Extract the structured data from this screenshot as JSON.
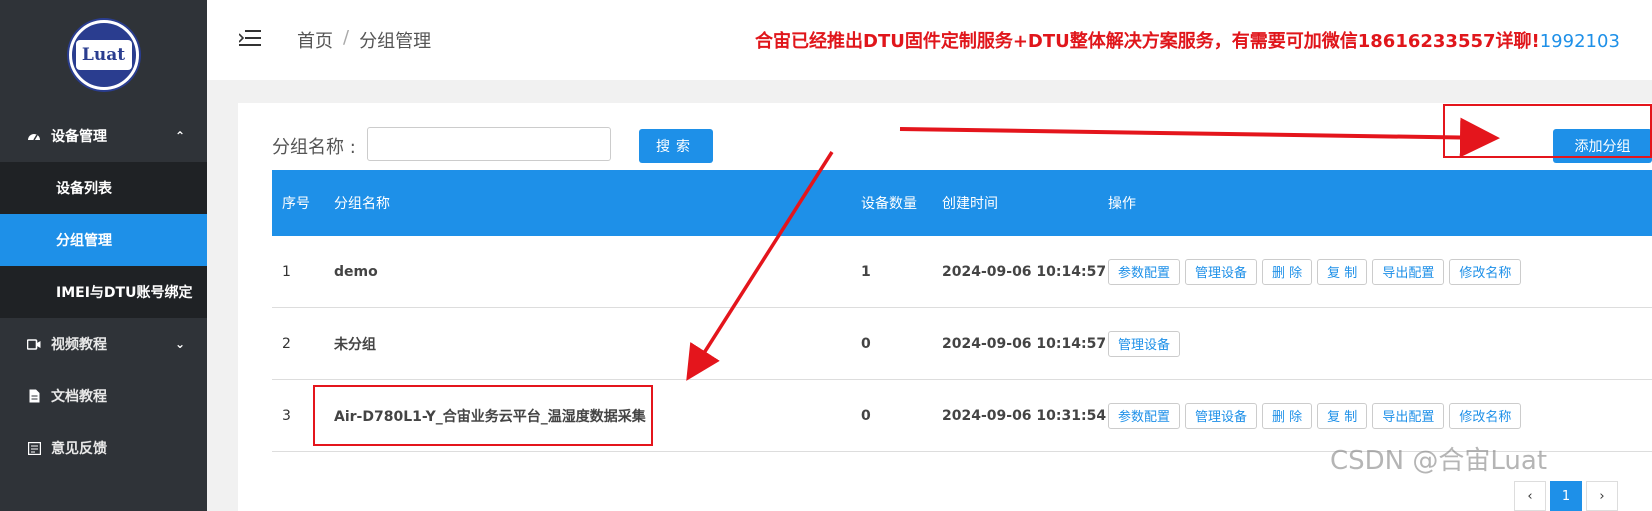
{
  "logo": {
    "text": "Luat"
  },
  "sidebar": {
    "items": [
      {
        "label": "设备管理",
        "icon": "dashboard-icon",
        "expanded": true,
        "children": [
          {
            "label": "设备列表",
            "active": false
          },
          {
            "label": "分组管理",
            "active": true
          },
          {
            "label": "IMEI与DTU账号绑定",
            "active": false
          }
        ]
      },
      {
        "label": "视频教程",
        "icon": "video-icon"
      },
      {
        "label": "文档教程",
        "icon": "document-icon"
      },
      {
        "label": "意见反馈",
        "icon": "feedback-icon"
      }
    ]
  },
  "header": {
    "breadcrumb": [
      "首页",
      "分组管理"
    ],
    "breadcrumb_sep": "/",
    "notice": "合宙已经推出DTU固件定制服务+DTU整体解决方案服务，有需要可加微信18616233557详聊!",
    "notice_qq": "1992103"
  },
  "search": {
    "label": "分组名称 :",
    "value": "",
    "button": "搜索"
  },
  "add_button": "添加分组",
  "table": {
    "headers": [
      "序号",
      "分组名称",
      "设备数量",
      "创建时间",
      "操作"
    ],
    "rows": [
      {
        "no": "1",
        "name": "demo",
        "count": "1",
        "time": "2024-09-06 10:14:57",
        "ops": [
          "参数配置",
          "管理设备",
          "删 除",
          "复 制",
          "导出配置",
          "修改名称"
        ]
      },
      {
        "no": "2",
        "name": "未分组",
        "count": "0",
        "time": "2024-09-06 10:14:57",
        "ops": [
          "管理设备"
        ]
      },
      {
        "no": "3",
        "name": "Air-D780L1-Y_合宙业务云平台_温湿度数据采集",
        "count": "0",
        "time": "2024-09-06 10:31:54",
        "ops": [
          "参数配置",
          "管理设备",
          "删 除",
          "复 制",
          "导出配置",
          "修改名称"
        ]
      }
    ]
  },
  "pagination": {
    "current": "1"
  },
  "watermark": "CSDN @合宙Luat",
  "colors": {
    "primary": "#1e90e8",
    "sidebar": "#2f3338",
    "annotation": "#e4151c",
    "notice": "#e0161b"
  }
}
